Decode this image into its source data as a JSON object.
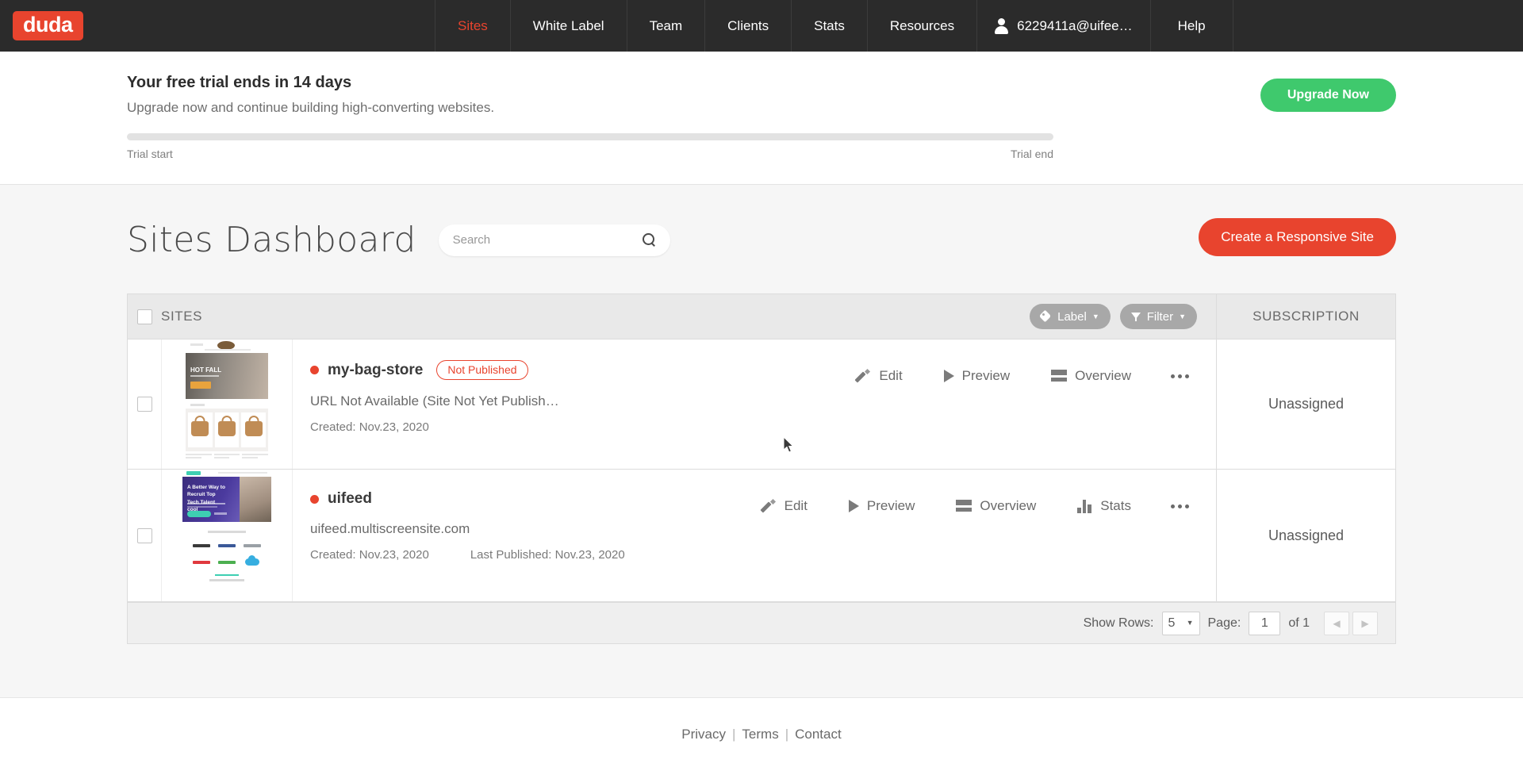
{
  "topnav": {
    "logo_text": "duda",
    "items": [
      {
        "label": "Sites",
        "active": true
      },
      {
        "label": "White Label",
        "active": false
      },
      {
        "label": "Team",
        "active": false
      },
      {
        "label": "Clients",
        "active": false
      },
      {
        "label": "Stats",
        "active": false
      },
      {
        "label": "Resources",
        "active": false
      }
    ],
    "user_label": "6229411a@uifee…",
    "help_label": "Help"
  },
  "trial": {
    "title": "Your free trial ends in 14 days",
    "subtitle": "Upgrade now and continue building high-converting websites.",
    "upgrade_label": "Upgrade Now",
    "start_label": "Trial start",
    "end_label": "Trial end",
    "progress_percent": 0,
    "accent_color": "#3fc96d"
  },
  "dashboard": {
    "title": "Sites Dashboard",
    "search_placeholder": "Search",
    "search_value": "",
    "create_label": "Create a Responsive Site",
    "create_color": "#e8442e"
  },
  "table": {
    "header": {
      "sites_label": "SITES",
      "label_button": "Label",
      "filter_button": "Filter",
      "subscription_label": "SUBSCRIPTION"
    },
    "rows": [
      {
        "name": "my-bag-store",
        "status_badge": "Not Published",
        "status_color": "#e8442e",
        "url": "URL Not Available (Site Not Yet Publish…",
        "created": "Created: Nov.23, 2020",
        "last_published": "",
        "subscription": "Unassigned",
        "actions": [
          "Edit",
          "Preview",
          "Overview"
        ]
      },
      {
        "name": "uifeed",
        "status_badge": "",
        "status_color": "#e8442e",
        "url": "uifeed.multiscreensite.com",
        "created": "Created: Nov.23, 2020",
        "last_published": "Last Published: Nov.23, 2020",
        "subscription": "Unassigned",
        "actions": [
          "Edit",
          "Preview",
          "Overview",
          "Stats"
        ]
      }
    ],
    "footer": {
      "show_rows_label": "Show Rows:",
      "show_rows_value": "5",
      "page_label": "Page:",
      "page_value": "1",
      "of_label": "of 1"
    }
  },
  "thumbnails": {
    "bag_store": {
      "hero_text": "HOT FALL"
    },
    "uifeed": {
      "hero_text": "A Better Way to Recruit Top Tech Talent cool"
    }
  },
  "footer": {
    "privacy": "Privacy",
    "terms": "Terms",
    "contact": "Contact",
    "separator": "|"
  }
}
